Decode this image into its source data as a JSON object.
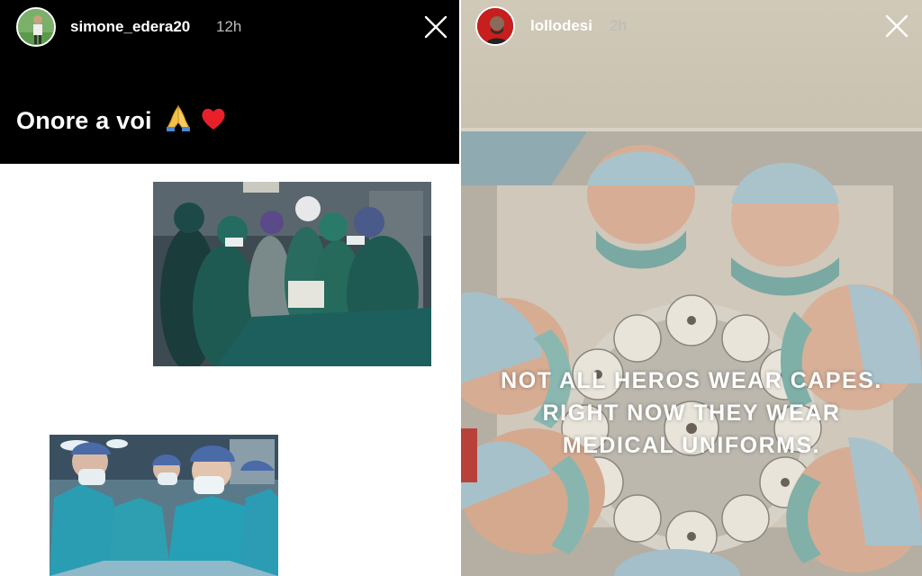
{
  "left_story": {
    "username": "simone_edera20",
    "time": "12h",
    "caption": "Onore a voi",
    "caption_emoji": "🙏❤️",
    "photos": [
      "surgical-team-photo",
      "surgeons-masks-photo"
    ]
  },
  "right_story": {
    "username": "lollodesi",
    "time": "2h",
    "overlay_lines": [
      "NOT ALL HEROS WEAR CAPES.",
      "RIGHT NOW THEY WEAR",
      "MEDICAL UNIFORMS."
    ]
  },
  "icons": {
    "close": "close-icon",
    "pray": "praying-hands-icon",
    "heart": "heart-icon"
  },
  "colors": {
    "surgical_green": "#1f6b63",
    "scrubs_teal": "#2aa1b4",
    "header_black": "#000000"
  }
}
